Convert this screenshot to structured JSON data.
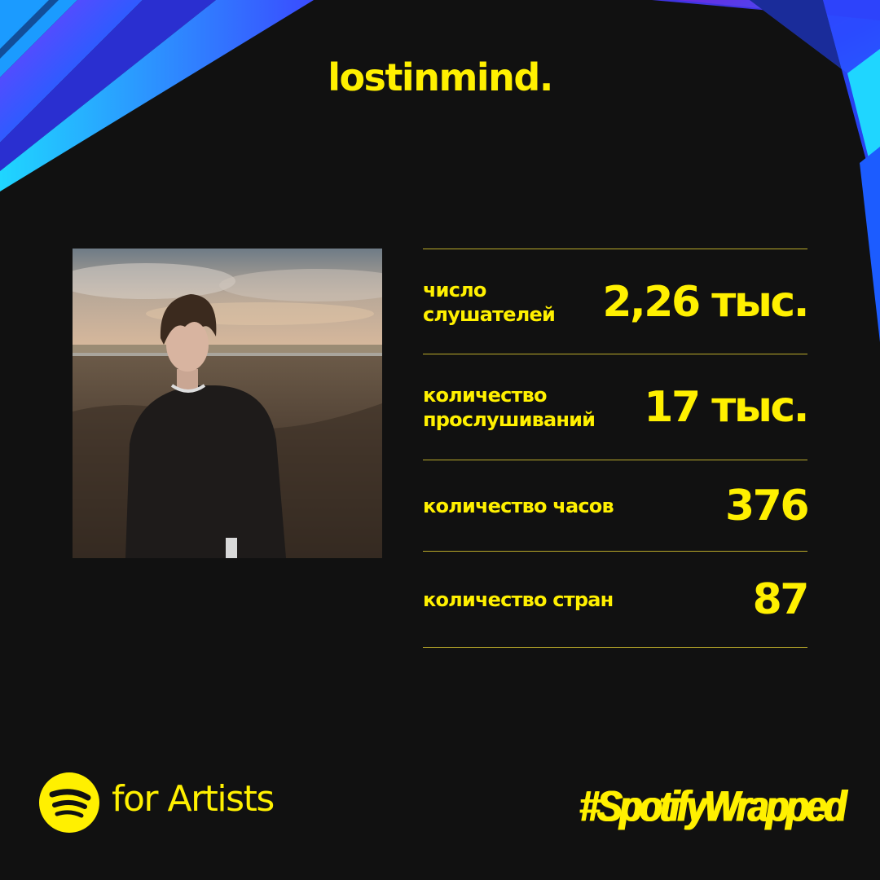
{
  "header": {
    "artist_name": "lostinmind."
  },
  "artist_photo": {
    "icon": "artist-portrait"
  },
  "stats": [
    {
      "label_lines": [
        "число",
        "слушателей"
      ],
      "value": "2,26 тыс."
    },
    {
      "label_lines": [
        "количество",
        "прослушиваний"
      ],
      "value": "17 тыс."
    },
    {
      "label_lines": [
        "количество часов"
      ],
      "value": "376"
    },
    {
      "label_lines": [
        "количество стран"
      ],
      "value": "87"
    }
  ],
  "footer": {
    "logo_icon": "spotify-logo-icon",
    "brand_text": "for Artists",
    "hashtag": "#SpotifyWrapped"
  },
  "colors": {
    "background": "#111111",
    "accent": "#FFF000",
    "divider": "#B9A92A",
    "decor_blue": "#2F6BFF",
    "decor_cyan": "#1FD6FF",
    "decor_purple": "#5A2BD8"
  }
}
